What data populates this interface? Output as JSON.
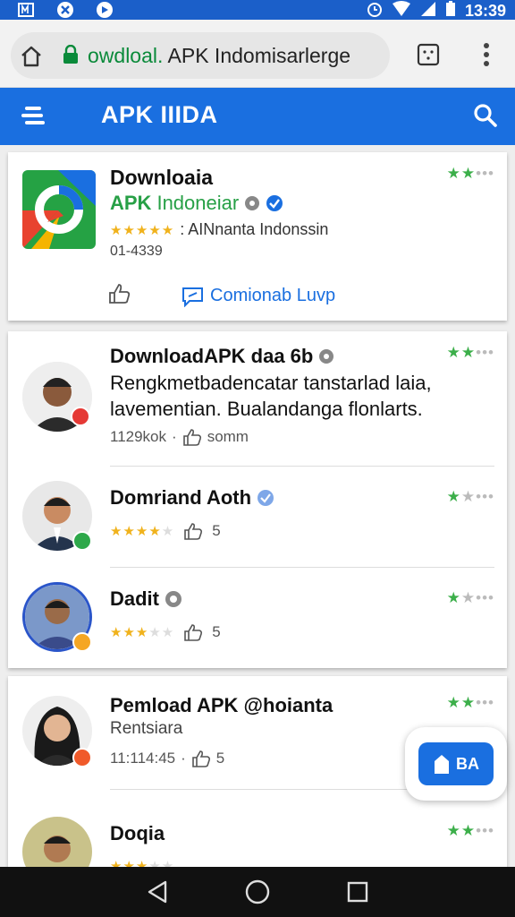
{
  "status_bar": {
    "time": "13:39"
  },
  "browser": {
    "url_green": "owdloal.",
    "url_rest": " APK Indomisarlerge"
  },
  "header": {
    "title": "APK IIIDA"
  },
  "featured": {
    "title": "Downloaia",
    "apk_label": "APK",
    "apk_name": "Indoneiar",
    "rating_text": ": AINnanta Indonssin",
    "number": "01-4339",
    "comment_label": "Comionab Luvp"
  },
  "reviews": [
    {
      "title": "DownloadAPK daa 6b",
      "body_line1": "Rengkmetbadencatar tanstarlad laia,",
      "body_line2": "lavementian. Bualandanga flonlarts.",
      "meta_count": "1129kok",
      "meta_label": "somm"
    },
    {
      "title": "Domriand Aoth",
      "likes": "5"
    },
    {
      "title": "Dadit",
      "likes": "5"
    },
    {
      "title": "Pemload APK @hoianta",
      "subtitle": "Rentsiara",
      "meta_count": "11:114:45",
      "likes": "5"
    },
    {
      "title": "Doqia"
    }
  ],
  "fab": {
    "label": "BA"
  },
  "colors": {
    "primary": "#1a6fe0",
    "status": "#1b5fc9",
    "green": "#27a046",
    "star": "#f0b21c"
  }
}
